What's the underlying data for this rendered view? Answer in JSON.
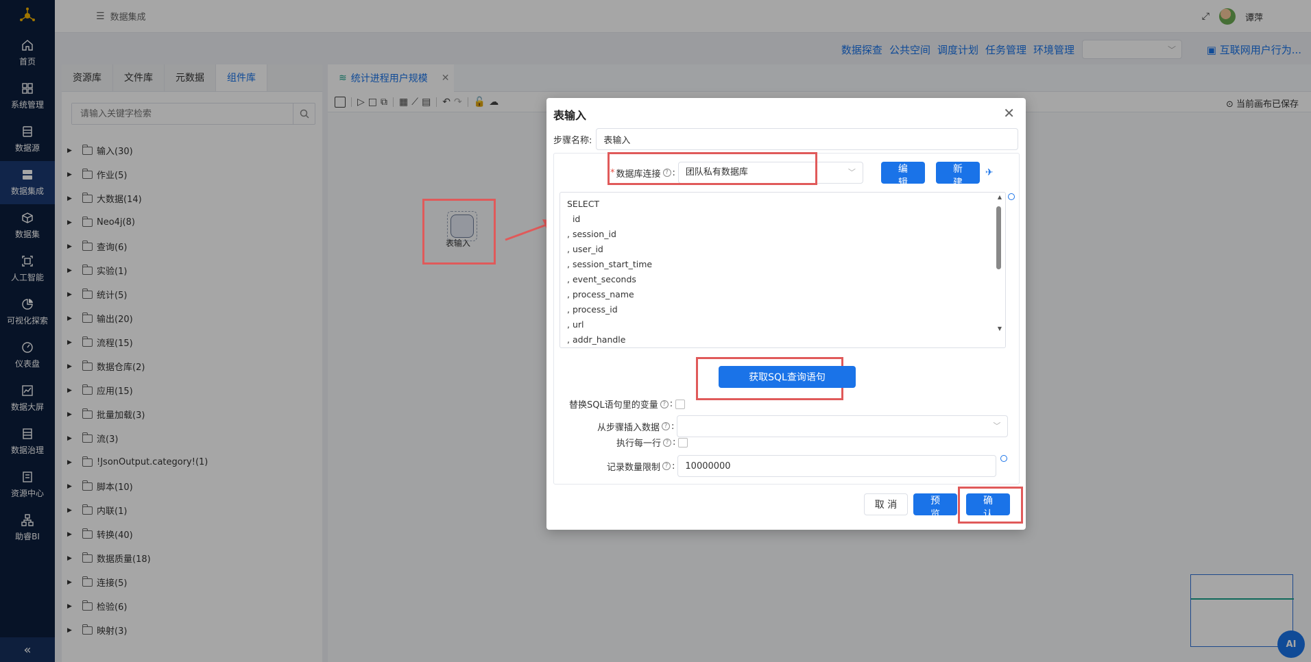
{
  "app": {
    "breadcrumb": "数据集成",
    "user_name": "谭萍"
  },
  "sidebar": {
    "items": [
      {
        "label": "首页",
        "icon": "home-icon"
      },
      {
        "label": "系统管理",
        "icon": "grid-icon"
      },
      {
        "label": "数据源",
        "icon": "database-icon"
      },
      {
        "label": "数据集成",
        "icon": "server-icon",
        "active": true
      },
      {
        "label": "数据集",
        "icon": "cube-icon"
      },
      {
        "label": "人工智能",
        "icon": "ai-icon"
      },
      {
        "label": "可视化探索",
        "icon": "pie-chart-icon"
      },
      {
        "label": "仪表盘",
        "icon": "gauge-icon"
      },
      {
        "label": "数据大屏",
        "icon": "line-chart-icon"
      },
      {
        "label": "数据治理",
        "icon": "list-icon"
      },
      {
        "label": "资源中心",
        "icon": "archive-icon"
      },
      {
        "label": "助睿BI",
        "icon": "org-chart-icon"
      }
    ],
    "collapse_label": "«"
  },
  "subnav": {
    "links": [
      "数据探查",
      "公共空间",
      "调度计划",
      "任务管理",
      "环境管理"
    ],
    "project_title": "互联网用户行为..."
  },
  "left_panel": {
    "tabs": [
      "资源库",
      "文件库",
      "元数据",
      "组件库"
    ],
    "active_tab": 3,
    "search_placeholder": "请输入关键字检索",
    "tree": [
      "输入(30)",
      "作业(5)",
      "大数据(14)",
      "Neo4j(8)",
      "查询(6)",
      "实验(1)",
      "统计(5)",
      "输出(20)",
      "流程(15)",
      "数据仓库(2)",
      "应用(15)",
      "批量加载(3)",
      "流(3)",
      "!JsonOutput.category!(1)",
      "脚本(10)",
      "内联(1)",
      "转换(40)",
      "数据质量(18)",
      "连接(5)",
      "检验(6)",
      "映射(3)"
    ]
  },
  "canvas": {
    "tab_title": "统计进程用户规模",
    "saved_status": "当前画布已保存",
    "node_label": "表输入",
    "ai_label": "AI"
  },
  "dialog": {
    "title": "表输入",
    "step_name_label": "步骤名称:",
    "step_name_value": "表输入",
    "db_conn_label": "数据库连接",
    "db_conn_value": "团队私有数据库",
    "edit_label": "编 辑",
    "new_label": "新 建",
    "sql_lines": [
      "SELECT",
      "  id",
      ", session_id",
      ", user_id",
      ", session_start_time",
      ", event_seconds",
      ", process_name",
      ", process_id",
      ", url",
      ", addr_handle"
    ],
    "get_sql_label": "获取SQL查询语句",
    "replace_var_label": "替换SQL语句里的变量",
    "insert_from_step_label": "从步骤插入数据",
    "exec_each_row_label": "执行每一行",
    "row_limit_label": "记录数量限制",
    "row_limit_value": "10000000",
    "cancel_label": "取 消",
    "preview_label": "预 览",
    "confirm_label": "确 认"
  },
  "colors": {
    "sidebar_bg": "#0c1e3d",
    "primary": "#1a73e8",
    "highlight": "#e05a5a"
  }
}
